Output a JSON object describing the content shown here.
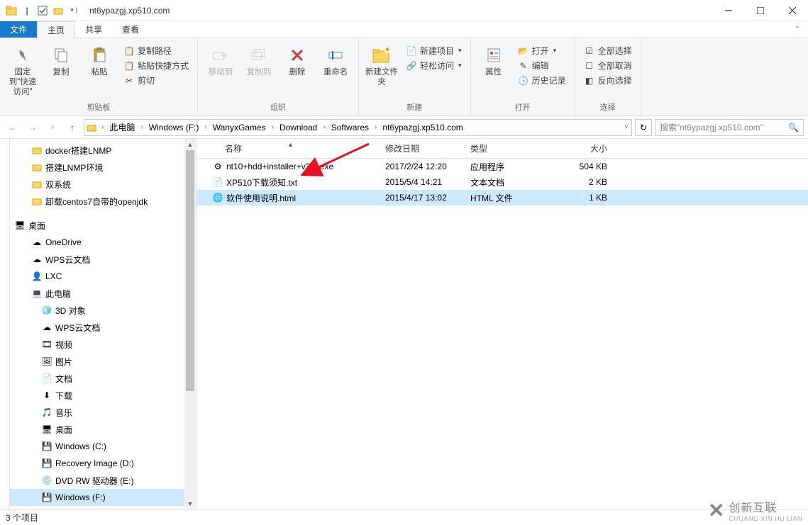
{
  "title": "nt6ypazgj.xp510.com",
  "tabs": {
    "file": "文件",
    "home": "主页",
    "share": "共享",
    "view": "查看"
  },
  "ribbon": {
    "clipboard": {
      "pin": "固定到\"快速访问\"",
      "copy": "复制",
      "paste": "粘贴",
      "copy_path": "复制路径",
      "paste_shortcut": "粘贴快捷方式",
      "cut": "剪切",
      "label": "剪贴板"
    },
    "organize": {
      "move_to": "移动到",
      "copy_to": "复制到",
      "delete": "删除",
      "rename": "重命名",
      "label": "组织"
    },
    "new": {
      "new_folder": "新建文件夹",
      "new_item": "新建项目",
      "easy_access": "轻松访问",
      "label": "新建"
    },
    "open": {
      "properties": "属性",
      "open": "打开",
      "edit": "编辑",
      "history": "历史记录",
      "label": "打开"
    },
    "select": {
      "select_all": "全部选择",
      "select_none": "全部取消",
      "invert": "反向选择",
      "label": "选择"
    }
  },
  "breadcrumb": [
    "此电脑",
    "Windows (F:)",
    "WanyxGames",
    "Download",
    "Softwares",
    "nt6ypazgj.xp510.com"
  ],
  "search_placeholder": "搜索\"nt6ypazgj.xp510.com\"",
  "tree": {
    "quick": [
      "docker搭建LNMP",
      "搭建LNMP环境",
      "双系统",
      "卸载centos7自带的openjdk"
    ],
    "desktop": "桌面",
    "items1": [
      "OneDrive",
      "WPS云文档",
      "LXC"
    ],
    "computer": "此电脑",
    "items2": [
      "3D 对象",
      "WPS云文档",
      "视频",
      "图片",
      "文档",
      "下载",
      "音乐",
      "桌面",
      "Windows (C:)",
      "Recovery Image (D:)",
      "DVD RW 驱动器 (E:)",
      "Windows (F:)"
    ]
  },
  "columns": {
    "name": "名称",
    "date": "修改日期",
    "type": "类型",
    "size": "大小"
  },
  "files": [
    {
      "name": "nt10+hdd+installer+v3.2.exe",
      "date": "2017/2/24 12:20",
      "type": "应用程序",
      "size": "504 KB",
      "icon": "exe"
    },
    {
      "name": "XP510下载须知.txt",
      "date": "2015/5/4 14:21",
      "type": "文本文档",
      "size": "2 KB",
      "icon": "txt"
    },
    {
      "name": "软件使用说明.html",
      "date": "2015/4/17 13:02",
      "type": "HTML 文件",
      "size": "1 KB",
      "icon": "html",
      "selected": true
    }
  ],
  "status": "3 个项目",
  "watermark": {
    "text": "创新互联",
    "sub": "CHUANG XIN HU LIAN"
  }
}
